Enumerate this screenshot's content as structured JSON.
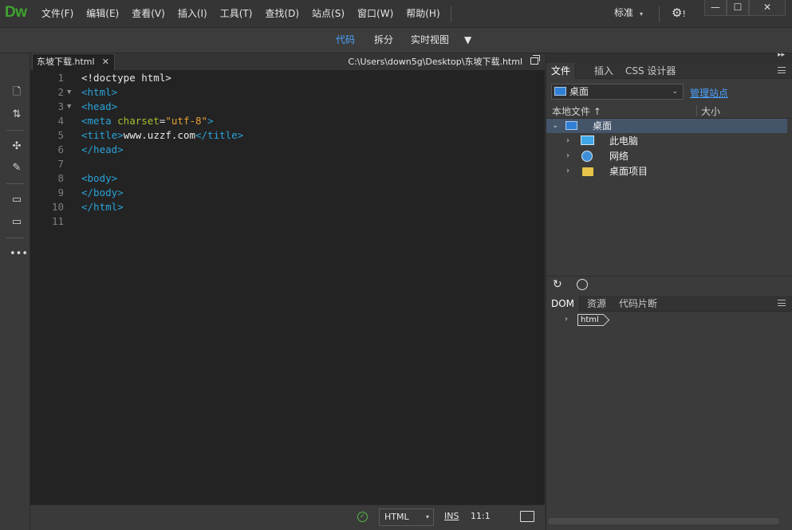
{
  "app": {
    "logo": "Dw",
    "menus": [
      "文件(F)",
      "编辑(E)",
      "查看(V)",
      "插入(I)",
      "工具(T)",
      "查找(D)",
      "站点(S)",
      "窗口(W)",
      "帮助(H)"
    ],
    "workspace_label": "标准",
    "window_buttons": {
      "minimize": "—",
      "maximize": "☐",
      "close": "✕"
    }
  },
  "viewbar": {
    "code": "代码",
    "split": "拆分",
    "live": "实时视图"
  },
  "document": {
    "tab_name": "东坡下载.html",
    "path": "C:\\Users\\down5g\\Desktop\\东坡下载.html"
  },
  "editor": {
    "line_numbers": [
      "1",
      "2",
      "3",
      "4",
      "5",
      "6",
      "7",
      "8",
      "9",
      "10",
      "11"
    ]
  },
  "statusbar": {
    "language": "HTML",
    "mode": "INS",
    "cursor": "11:1"
  },
  "files_panel": {
    "tabs": [
      "文件",
      "插入",
      "CSS 设计器"
    ],
    "site": "桌面",
    "manage_site": "管理站点",
    "columns": {
      "name": "本地文件",
      "sort_arrow": "↑",
      "size": "大小"
    },
    "tree": [
      {
        "label": "桌面",
        "level": 0,
        "expanded": true,
        "icon": "desktop-icon"
      },
      {
        "label": "此电脑",
        "level": 1,
        "expanded": false,
        "icon": "computer-icon"
      },
      {
        "label": "网络",
        "level": 1,
        "expanded": false,
        "icon": "network-icon"
      },
      {
        "label": "桌面项目",
        "level": 1,
        "expanded": false,
        "icon": "folder-icon"
      }
    ]
  },
  "dom_panel": {
    "tabs": [
      "DOM",
      "资源",
      "代码片断"
    ],
    "root_node": "html"
  },
  "colors": {
    "accent": "#4aa3ff",
    "logo": "#3fa32f",
    "tag": "#2aa3d8",
    "attr": "#a0c030",
    "string": "#e8a235",
    "editor_bg": "#232323"
  }
}
